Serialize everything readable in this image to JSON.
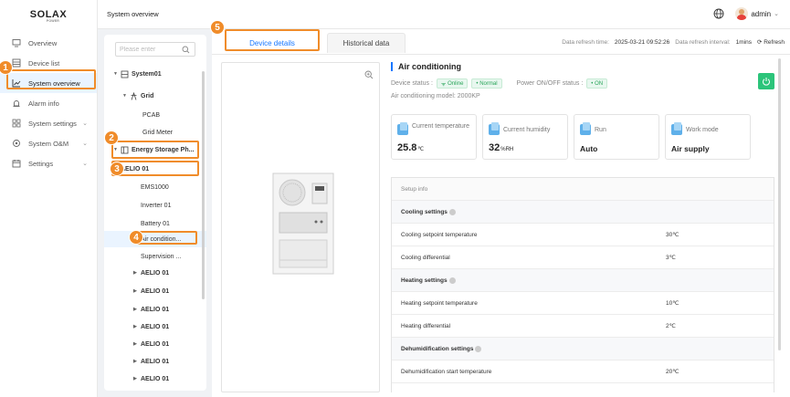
{
  "app": {
    "logo": "SOLAX",
    "logo_sub": "POWER"
  },
  "header": {
    "title": "System overview",
    "user": "admin"
  },
  "sidebar": {
    "items": [
      {
        "label": "Overview",
        "icon": "monitor-icon"
      },
      {
        "label": "Device list",
        "icon": "list-icon"
      },
      {
        "label": "System overview",
        "icon": "chart-icon",
        "active": true
      },
      {
        "label": "Alarm info",
        "icon": "alarm-icon"
      },
      {
        "label": "System settings",
        "icon": "grid-icon",
        "chevron": true
      },
      {
        "label": "System O&M",
        "icon": "wrench-icon",
        "chevron": true
      },
      {
        "label": "Settings",
        "icon": "calendar-icon",
        "chevron": true
      }
    ]
  },
  "tree": {
    "search_placeholder": "Please enter",
    "nodes": [
      {
        "label": "System01",
        "bold": true
      },
      {
        "label": "Grid",
        "bold": true
      },
      {
        "label": "PCAB"
      },
      {
        "label": "Grid Meter"
      },
      {
        "label": "Energy Storage Ph...",
        "bold": true
      },
      {
        "label": "AELIO 01",
        "bold": true
      },
      {
        "label": "EMS1000"
      },
      {
        "label": "Inverter 01"
      },
      {
        "label": "Battery 01"
      },
      {
        "label": "Air condition..."
      },
      {
        "label": "Supervision ..."
      },
      {
        "label": "AELIO 01",
        "bold": true
      },
      {
        "label": "AELIO 01",
        "bold": true
      },
      {
        "label": "AELIO 01",
        "bold": true
      },
      {
        "label": "AELIO 01",
        "bold": true
      },
      {
        "label": "AELIO 01",
        "bold": true
      },
      {
        "label": "AELIO 01",
        "bold": true
      },
      {
        "label": "AELIO 01",
        "bold": true
      }
    ]
  },
  "tabs": {
    "details": "Device details",
    "history": "Historical data"
  },
  "refresh": {
    "time_label": "Data refresh time:",
    "time_value": "2025-03-21 09:52:26",
    "interval_label": "Data refresh interval:",
    "interval_value": "1mins",
    "refresh_label": "Refresh"
  },
  "device": {
    "title": "Air conditioning",
    "status_label": "Device status :",
    "status_online": "Online",
    "status_normal": "Normal",
    "power_label": "Power ON/OFF status :",
    "power_value": "ON",
    "model_label": "Air conditioning model:",
    "model_value": "2000KP"
  },
  "metrics": [
    {
      "label": "Current temperature",
      "value": "25.8",
      "unit": "℃"
    },
    {
      "label": "Current humidity",
      "value": "32",
      "unit": "%RH"
    },
    {
      "label": "Run",
      "value": "Auto",
      "unit": ""
    },
    {
      "label": "Work mode",
      "value": "Air supply",
      "unit": ""
    }
  ],
  "setup": {
    "header": "Setup info",
    "rows": [
      {
        "type": "sec",
        "label": "Cooling settings"
      },
      {
        "type": "row",
        "label": "Cooling setpoint temperature",
        "value": "30℃"
      },
      {
        "type": "row",
        "label": "Cooling differential",
        "value": "3℃"
      },
      {
        "type": "sec",
        "label": "Heating settings"
      },
      {
        "type": "row",
        "label": "Heating setpoint temperature",
        "value": "10℃"
      },
      {
        "type": "row",
        "label": "Heating differential",
        "value": "2℃"
      },
      {
        "type": "sec",
        "label": "Dehumidification settings"
      },
      {
        "type": "row",
        "label": "Dehumidification start temperature",
        "value": "20℃"
      }
    ]
  },
  "callouts": [
    "1",
    "2",
    "3",
    "4",
    "5"
  ],
  "colors": {
    "accent": "#1677ff",
    "callout": "#f08c2a",
    "online": "#2aa55a",
    "power": "#2cc47a"
  }
}
